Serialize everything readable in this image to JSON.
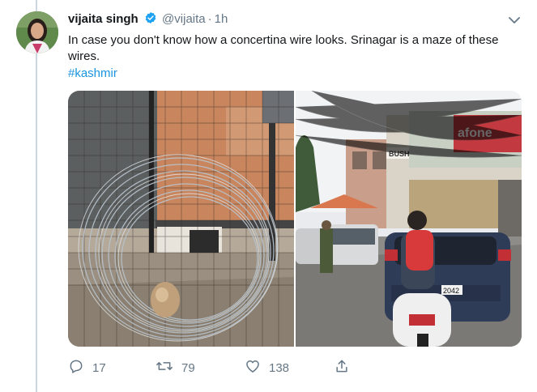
{
  "tweet": {
    "author_name": "vijaita singh",
    "handle": "@vijaita",
    "separator": "·",
    "time": "1h",
    "text": "In case you don't know how a concertina wire looks. Srinagar is a maze of these wires.",
    "hashtag": "#kashmir",
    "verified": true
  },
  "stats": {
    "replies": "17",
    "retweets": "79",
    "likes": "138"
  },
  "media": {
    "photo_count": 2,
    "signage": [
      "BUSH",
      "afone",
      "2042"
    ]
  },
  "colors": {
    "link": "#1b95e0",
    "secondary_text": "#657786",
    "primary_text": "#14171a",
    "verified_badge": "#1da1f2",
    "thread_line": "#ccd6dd"
  },
  "icons": [
    "verified-icon",
    "chevron-down-icon",
    "reply-icon",
    "retweet-icon",
    "like-icon",
    "share-icon"
  ]
}
